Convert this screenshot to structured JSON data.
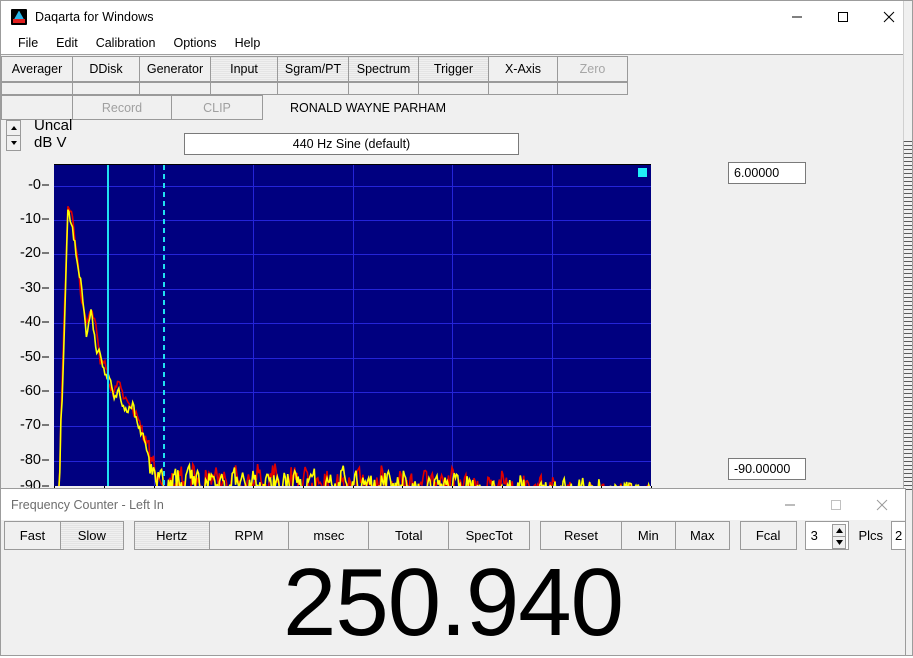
{
  "main_window": {
    "title": "Daqarta for Windows",
    "icon": "daqarta-logo-icon",
    "window_controls": {
      "minimize": "minimize-icon",
      "maximize": "maximize-icon",
      "close": "close-icon"
    },
    "menu": [
      "File",
      "Edit",
      "Calibration",
      "Options",
      "Help"
    ],
    "tabs": [
      {
        "label": "Averager",
        "state": "normal"
      },
      {
        "label": "DDisk",
        "state": "normal"
      },
      {
        "label": "Generator",
        "state": "normal"
      },
      {
        "label": "Input",
        "state": "active"
      },
      {
        "label": "Sgram/PT",
        "state": "active"
      },
      {
        "label": "Spectrum",
        "state": "active"
      },
      {
        "label": "Trigger",
        "state": "active"
      },
      {
        "label": "X-Axis",
        "state": "normal"
      },
      {
        "label": "Zero",
        "state": "disabled"
      }
    ],
    "command_row": {
      "blank": "",
      "record": "Record",
      "clip": "CLIP",
      "user": "RONALD WAYNE PARHAM"
    },
    "scale": {
      "units_line1": "Uncal",
      "units_line2": "dB V",
      "spinner_up": "up-arrow-icon",
      "spinner_down": "down-arrow-icon"
    },
    "generator_label": "440 Hz Sine (default)",
    "top_value": "6.00000",
    "bottom_value": "-90.00000"
  },
  "chart_data": {
    "type": "line",
    "title": "440 Hz Sine (default)",
    "xlabel": "",
    "ylabel": "Uncal dB V",
    "ylim": [
      -90,
      6
    ],
    "yticks": [
      0,
      -10,
      -20,
      -30,
      -40,
      -50,
      -60,
      -70,
      -80,
      -90
    ],
    "ytick_labels": [
      "-0",
      "-10",
      "-20",
      "-30",
      "-40",
      "-50",
      "-60",
      "-70",
      "-80",
      "-90"
    ],
    "grid": true,
    "background": "#000080",
    "gridcolor": "#2424d8",
    "series": [
      {
        "name": "trace-red",
        "color": "#e00000"
      },
      {
        "name": "trace-yellow",
        "color": "#ffff00"
      }
    ],
    "cursors": [
      {
        "name": "main-cursor",
        "style": "solid",
        "color": "#20e0f0",
        "x_frac": 0.088
      },
      {
        "name": "delta-cursor",
        "style": "dashed",
        "color": "#20e0f0",
        "x_frac": 0.183
      }
    ],
    "corner_marker": {
      "color": "#20f0f8",
      "position": "top-right"
    },
    "trace_red": [
      -90,
      -90,
      -47,
      -6,
      -9,
      -20,
      -34,
      -40,
      -37,
      -40,
      -52,
      -51,
      -58,
      -60,
      -57,
      -62,
      -63,
      -65,
      -67,
      -70,
      -75,
      -79,
      -84,
      -86,
      -90,
      -85,
      -88,
      -83,
      -86,
      -90,
      -81,
      -85,
      -89,
      -84,
      -87,
      -82,
      -88,
      -85,
      -90,
      -83,
      -86,
      -90,
      -84,
      -88,
      -81,
      -87,
      -90,
      -85,
      -83,
      -88,
      -90,
      -86,
      -82,
      -89,
      -84,
      -87,
      -90,
      -85,
      -88,
      -83,
      -90,
      -87,
      -84,
      -89,
      -86,
      -90,
      -82,
      -88,
      -85,
      -90,
      -87,
      -83,
      -89,
      -86,
      -90,
      -84,
      -88,
      -85,
      -90,
      -87,
      -83,
      -89,
      -86,
      -90,
      -85,
      -88,
      -82,
      -90,
      -87,
      -84,
      -89,
      -86,
      -90,
      -88,
      -85,
      -90,
      -87,
      -84,
      -89,
      -86,
      -90,
      -88,
      -86,
      -90,
      -87,
      -85,
      -90,
      -88,
      -86,
      -90,
      -89,
      -87,
      -90,
      -88,
      -90,
      -89,
      -87,
      -90,
      -88,
      -90,
      -89,
      -90,
      -88,
      -90,
      -89,
      -90,
      -90,
      -89,
      -90,
      -90
    ],
    "trace_yellow": [
      -90,
      -90,
      -52,
      -7,
      -12,
      -22,
      -30,
      -44,
      -36,
      -47,
      -49,
      -55,
      -56,
      -62,
      -59,
      -64,
      -66,
      -63,
      -69,
      -72,
      -77,
      -81,
      -86,
      -83,
      -90,
      -88,
      -84,
      -86,
      -90,
      -82,
      -87,
      -83,
      -90,
      -86,
      -84,
      -89,
      -85,
      -90,
      -87,
      -82,
      -88,
      -85,
      -90,
      -83,
      -87,
      -90,
      -84,
      -88,
      -86,
      -90,
      -85,
      -89,
      -83,
      -87,
      -90,
      -86,
      -84,
      -88,
      -90,
      -85,
      -87,
      -90,
      -83,
      -86,
      -89,
      -84,
      -90,
      -87,
      -85,
      -88,
      -90,
      -86,
      -84,
      -90,
      -88,
      -87,
      -85,
      -90,
      -86,
      -89,
      -90,
      -85,
      -88,
      -87,
      -90,
      -86,
      -89,
      -84,
      -90,
      -88,
      -86,
      -90,
      -87,
      -89,
      -90,
      -86,
      -88,
      -90,
      -87,
      -90,
      -89,
      -86,
      -90,
      -88,
      -90,
      -87,
      -89,
      -90,
      -88,
      -90,
      -86,
      -90,
      -89,
      -90,
      -87,
      -90,
      -89,
      -90,
      -88,
      -90,
      -90,
      -89,
      -90,
      -90,
      -89,
      -90,
      -88,
      -90,
      -90,
      -90
    ]
  },
  "freq_counter": {
    "title": "Frequency Counter - Left In",
    "window_controls": {
      "minimize": "minimize-icon",
      "maximize": "maximize-icon",
      "close": "close-icon"
    },
    "buttons": [
      {
        "label": "Fast",
        "state": "normal"
      },
      {
        "label": "Slow",
        "state": "active"
      },
      {
        "label": "Hertz",
        "state": "active"
      },
      {
        "label": "RPM",
        "state": "normal"
      },
      {
        "label": "msec",
        "state": "normal"
      },
      {
        "label": "Total",
        "state": "normal"
      },
      {
        "label": "SpecTot",
        "state": "normal"
      },
      {
        "label": "Reset",
        "state": "normal"
      },
      {
        "label": "Min",
        "state": "normal"
      },
      {
        "label": "Max",
        "state": "normal"
      },
      {
        "label": "Fcal",
        "state": "normal"
      }
    ],
    "places_value": "3",
    "places_label": "Plcs",
    "extra_field_value": "2",
    "readout": "250.940"
  }
}
